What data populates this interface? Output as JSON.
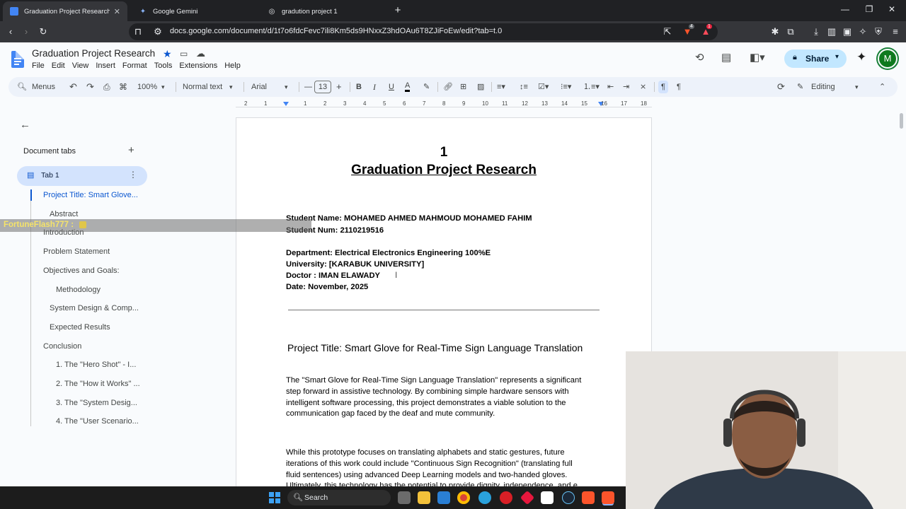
{
  "browser": {
    "tabs": [
      {
        "title": "Graduation Project Research - Goog",
        "active": true
      },
      {
        "title": "Google Gemini",
        "active": false
      },
      {
        "title": "gradution project 1",
        "active": false
      }
    ],
    "url": "docs.google.com/document/d/1t7o6fdcFevc7ili8Km5ds9HNxxZ3hdOAu6T8ZJiFoEw/edit?tab=t.0",
    "brave_badge": "4",
    "alert_badge": "1"
  },
  "docs": {
    "title": "Graduation Project Research",
    "menu": [
      "File",
      "Edit",
      "View",
      "Insert",
      "Format",
      "Tools",
      "Extensions",
      "Help"
    ],
    "share_label": "Share",
    "avatar_letter": "M",
    "toolbar": {
      "menus_label": "Menus",
      "zoom": "100%",
      "style": "Normal text",
      "font": "Arial",
      "font_size": "13",
      "mode": "Editing"
    },
    "ruler_marks": [
      "2",
      "1",
      "1",
      "2",
      "3",
      "4",
      "5",
      "6",
      "7",
      "8",
      "9",
      "10",
      "11",
      "12",
      "13",
      "14",
      "15",
      "16",
      "17",
      "18"
    ]
  },
  "sidebar": {
    "heading": "Document tabs",
    "tab_label": "Tab 1",
    "outline": [
      {
        "label": "Project Title: Smart Glove...",
        "level": 1,
        "active": true
      },
      {
        "label": "Abstract",
        "level": 2
      },
      {
        "label": "Introduction",
        "level": 1
      },
      {
        "label": "Problem Statement",
        "level": 1
      },
      {
        "label": "Objectives and Goals:",
        "level": 1
      },
      {
        "label": "Methodology",
        "level": 3
      },
      {
        "label": "System Design & Comp...",
        "level": 2
      },
      {
        "label": "Expected Results",
        "level": 2
      },
      {
        "label": "Conclusion",
        "level": 1
      },
      {
        "label": "1. The \"Hero Shot\" - I...",
        "level": 3
      },
      {
        "label": "2. The \"How it Works\" ...",
        "level": 3
      },
      {
        "label": "3. The \"System Desig...",
        "level": 3
      },
      {
        "label": "4. The \"User Scenario...",
        "level": 3
      }
    ]
  },
  "document": {
    "page_number": "1",
    "heading": "Graduation Project Research",
    "info": [
      "Student Name: MOHAMED AHMED MAHMOUD MOHAMED FAHIM",
      "Student Num:  2110219516",
      "Department: Electrical Electronics Engineering 100%E",
      "University: [KARABUK UNIVERSITY]",
      "Doctor : IMAN ELAWADY",
      "Date: November, 2025"
    ],
    "project_title": "Project Title: Smart Glove for Real-Time Sign Language Translation",
    "para1": [
      "The \"Smart Glove for Real-Time Sign Language Translation\" represents a significant",
      "step forward in assistive technology. By combining simple hardware sensors with",
      "intelligent software processing, this project demonstrates a viable solution to the",
      "communication gap faced by the deaf and mute community."
    ],
    "para2": [
      "While this prototype focuses on translating alphabets and static gestures, future",
      "iterations of this work could include \"Continuous Sign Recognition\" (translating full",
      "fluid sentences) using advanced Deep Learning models and two-handed gloves.",
      "Ultimately, this technology has the potential to provide dignity, independence, and e"
    ]
  },
  "overlay": {
    "stream_text": "FortuneFlash777 :"
  },
  "taskbar": {
    "search_placeholder": "Search"
  }
}
